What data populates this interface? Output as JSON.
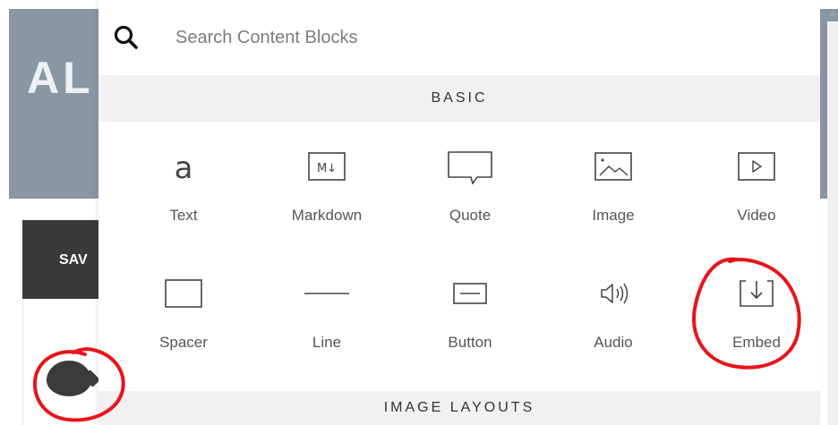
{
  "background": {
    "page_title_fragment": "AL",
    "save_button_fragment": "SAV"
  },
  "search": {
    "placeholder": "Search Content Blocks",
    "value": ""
  },
  "sections": {
    "basic": "BASIC",
    "image_layouts": "IMAGE LAYOUTS"
  },
  "blocks": [
    {
      "label": "Text",
      "icon": "text-icon"
    },
    {
      "label": "Markdown",
      "icon": "markdown-icon"
    },
    {
      "label": "Quote",
      "icon": "quote-icon"
    },
    {
      "label": "Image",
      "icon": "image-icon"
    },
    {
      "label": "Video",
      "icon": "video-icon"
    },
    {
      "label": "Spacer",
      "icon": "spacer-icon"
    },
    {
      "label": "Line",
      "icon": "line-icon"
    },
    {
      "label": "Button",
      "icon": "button-icon"
    },
    {
      "label": "Audio",
      "icon": "audio-icon"
    },
    {
      "label": "Embed",
      "icon": "embed-icon"
    }
  ],
  "icon_glyphs": {
    "text": "a",
    "markdown": "M↓"
  },
  "colors": {
    "banner": "#8a96a3",
    "save_button": "#3a3a3a",
    "section_header_bg": "#f1f1f1",
    "annotation": "#e8141b"
  }
}
